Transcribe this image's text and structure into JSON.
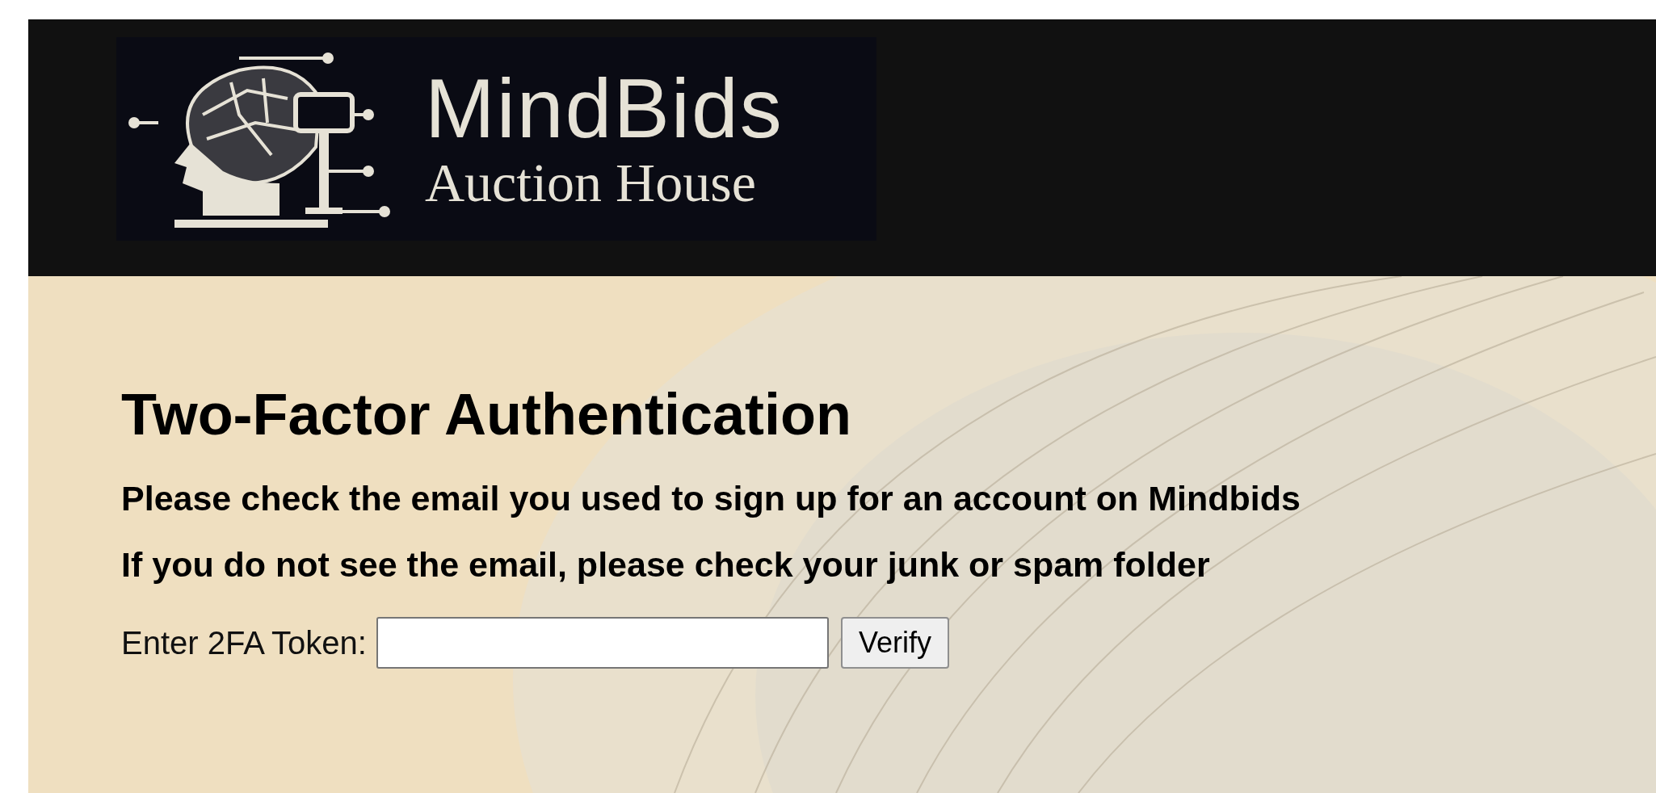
{
  "logo": {
    "title": "MindBids",
    "subtitle": "Auction House"
  },
  "heading": "Two-Factor Authentication",
  "messages": [
    "Please check the email you used to sign up for an account on Mindbids",
    "If you do not see the email, please check your junk or spam folder"
  ],
  "form": {
    "label": "Enter 2FA Token:",
    "button": "Verify"
  }
}
